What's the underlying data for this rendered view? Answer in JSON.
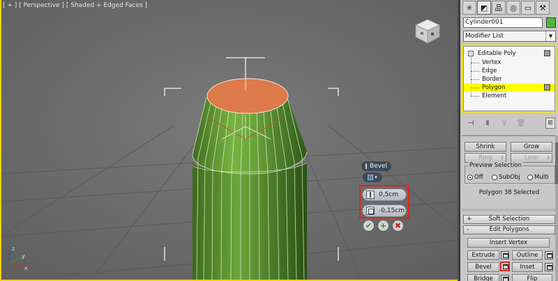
{
  "viewport": {
    "label": "[ + ] [ Perspective ] [ Shaded + Edged Faces ]",
    "axis_labels": {
      "z": "z",
      "x": "x",
      "y": "y"
    }
  },
  "caddy": {
    "title": "Bevel",
    "field1_value": "0,5cm",
    "field2_value": "-0,15cm",
    "ok_glyph": "✔",
    "apply_glyph": "+",
    "cancel_glyph": "✖"
  },
  "viewcube": {
    "icon": "viewcube-icon"
  },
  "panel": {
    "tabs": [
      {
        "icon": "create-icon",
        "glyph": "✳"
      },
      {
        "icon": "modify-icon",
        "glyph": "◩"
      },
      {
        "icon": "hierarchy-icon",
        "glyph": "品"
      },
      {
        "icon": "motion-icon",
        "glyph": "◎"
      },
      {
        "icon": "display-icon",
        "glyph": "▭"
      },
      {
        "icon": "utilities-icon",
        "glyph": "⚒"
      }
    ],
    "object_name": "Cylinder001",
    "object_color": "#51b73a",
    "modifier_list": "Modifier List",
    "stack": {
      "root": "Editable Poly",
      "items": [
        "Vertex",
        "Edge",
        "Border",
        "Polygon",
        "Element"
      ],
      "selected": "Polygon"
    },
    "stack_tools": {
      "pin": "⊣",
      "show_end": "Ⅱ",
      "unique": "∀",
      "remove": "🗑",
      "configure": "⊞"
    },
    "selection": {
      "shrink": "Shrink",
      "grow": "Grow",
      "ring": "Ring",
      "loop": "Loop",
      "preview_title": "Preview Selection",
      "preview_off": "Off",
      "preview_subobj": "SubObj",
      "preview_multi": "Multi",
      "info": "Polygon 38 Selected"
    },
    "soft_selection": {
      "sign": "+",
      "label": "Soft Selection"
    },
    "edit_polygons": {
      "sign": "-",
      "label": "Edit Polygons",
      "insert_vertex": "Insert Vertex",
      "extrude": "Extrude",
      "outline": "Outline",
      "bevel": "Bevel",
      "inset": "Inset",
      "bridge": "Bridge",
      "flip": "Flip"
    }
  },
  "colors": {
    "selection_yellow": "#ffff00",
    "highlight_red": "#e0241c",
    "mesh_green": "#5fa23a",
    "polygon_orange": "#dd7a4a"
  }
}
